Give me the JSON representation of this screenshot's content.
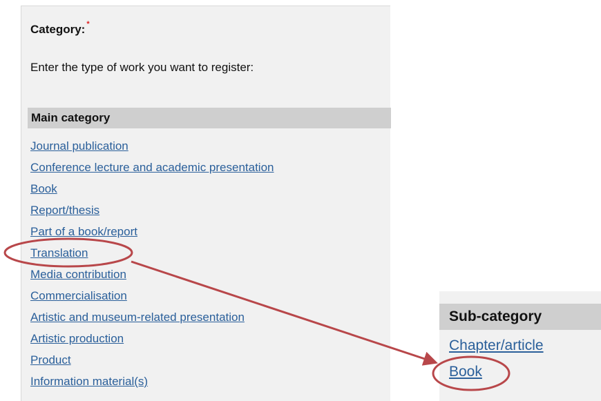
{
  "form": {
    "category_label": "Category:",
    "required_marker": "*",
    "instruction": "Enter the type of work you want to register:"
  },
  "main_category": {
    "header": "Main category",
    "items": [
      "Journal publication",
      "Conference lecture and academic presentation",
      "Book",
      "Report/thesis",
      "Part of a book/report",
      "Translation",
      "Media contribution",
      "Commercialisation",
      "Artistic and museum-related presentation",
      "Artistic production",
      "Product",
      "Information material(s)"
    ]
  },
  "sub_category": {
    "header": "Sub-category",
    "items": [
      "Chapter/article",
      "Book"
    ]
  },
  "colors": {
    "link": "#2a5f9a",
    "annotation": "#b8474a",
    "panel_bg": "#f1f1f1",
    "header_bg": "#cfcfcf",
    "required": "#e02020"
  }
}
